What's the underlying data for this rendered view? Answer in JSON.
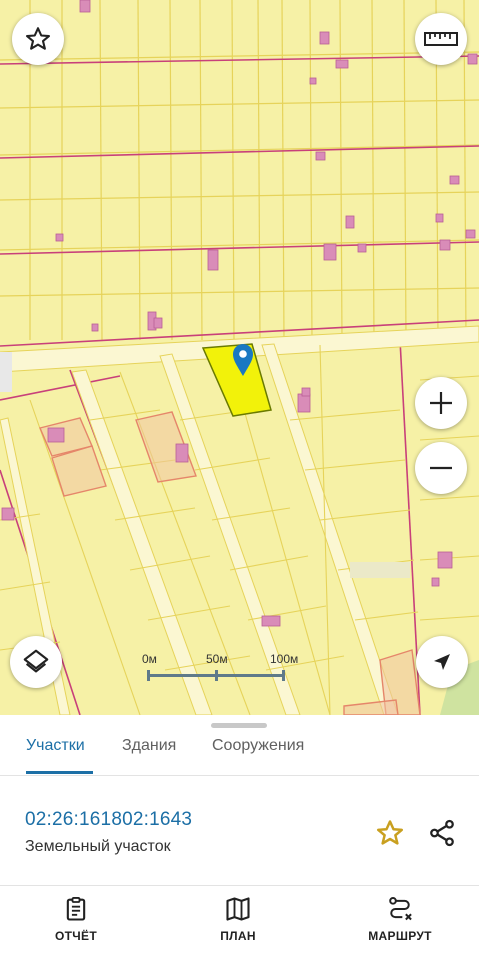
{
  "map": {
    "scale_bar": {
      "labels": [
        "0м",
        "50м",
        "100м"
      ]
    },
    "controls": {
      "favorite": "star-outline-icon",
      "ruler": "ruler-icon",
      "zoom_in": "plus-icon",
      "zoom_out": "minus-icon",
      "layers": "layers-icon",
      "locate": "navigation-arrow-icon"
    },
    "colors": {
      "parcel_fill": "#f6f1a6",
      "parcel_border": "#e6d35a",
      "selected_parcel": "#f2f20a",
      "building": "#d98cb8",
      "road_line": "#c8407a",
      "marker": "#1a78c2"
    }
  },
  "sheet": {
    "tabs": [
      {
        "label": "Участки",
        "active": true
      },
      {
        "label": "Здания",
        "active": false
      },
      {
        "label": "Сооружения",
        "active": false
      }
    ],
    "parcel": {
      "cadastral_number": "02:26:161802:1643",
      "type": "Земельный участок"
    },
    "actions": {
      "favorite_icon": "star-outline-icon",
      "share_icon": "share-icon"
    },
    "bottom_nav": [
      {
        "label": "ОТЧЁТ",
        "icon": "clipboard-icon"
      },
      {
        "label": "ПЛАН",
        "icon": "map-icon"
      },
      {
        "label": "МАРШРУТ",
        "icon": "route-icon"
      }
    ],
    "accent_color": "#1c6fa6"
  }
}
